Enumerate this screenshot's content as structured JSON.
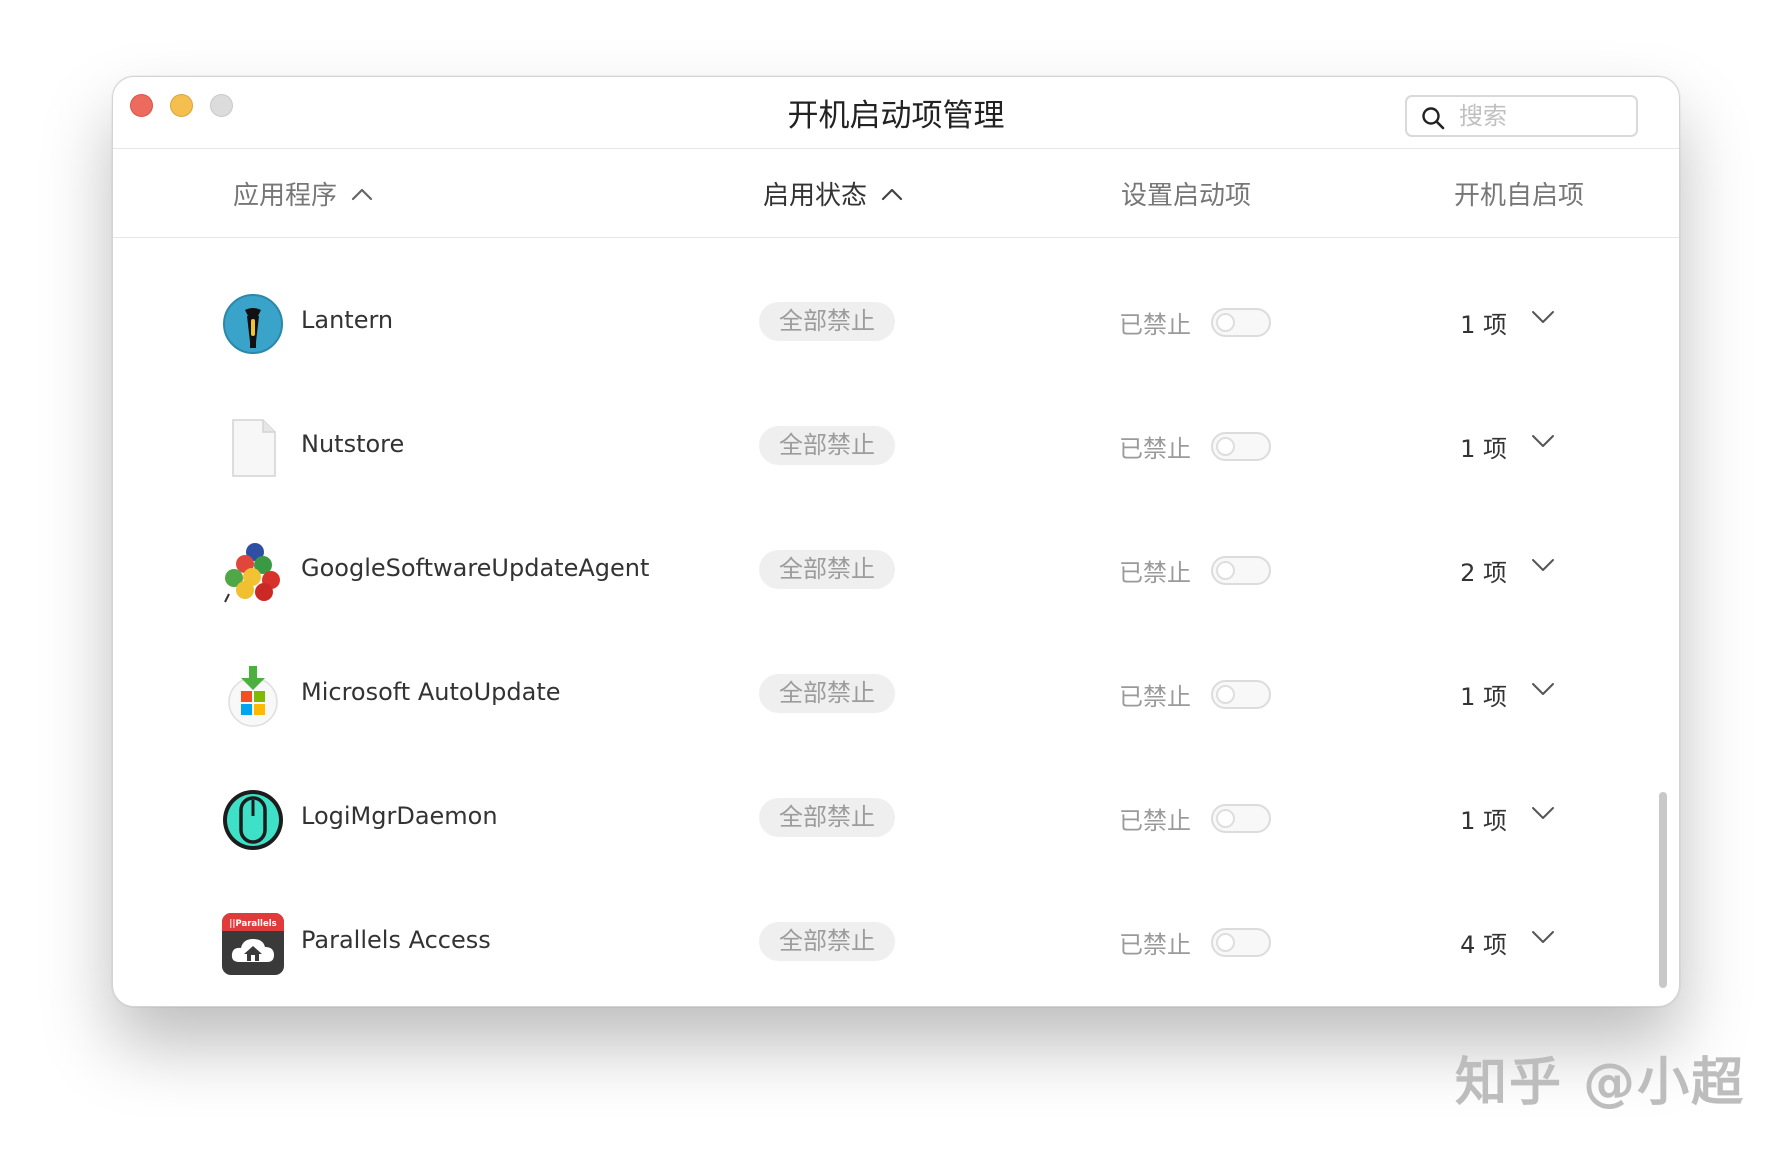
{
  "window": {
    "title": "开机启动项管理"
  },
  "search": {
    "placeholder": "搜索"
  },
  "columns": {
    "apps": "应用程序",
    "status": "启用状态",
    "setting": "设置启动项",
    "autostart": "开机自启项"
  },
  "rows": [
    {
      "name": "Lantern",
      "icon": "lantern-icon",
      "status": "全部禁止",
      "setting_label": "已禁止",
      "enabled": false,
      "count": "1 项"
    },
    {
      "name": "Nutstore",
      "icon": "document-icon",
      "status": "全部禁止",
      "setting_label": "已禁止",
      "enabled": false,
      "count": "1 项"
    },
    {
      "name": "GoogleSoftwareUpdateAgent",
      "icon": "colored-balls-icon",
      "status": "全部禁止",
      "setting_label": "已禁止",
      "enabled": false,
      "count": "2 项"
    },
    {
      "name": "Microsoft AutoUpdate",
      "icon": "microsoft-autoupdate-icon",
      "status": "全部禁止",
      "setting_label": "已禁止",
      "enabled": false,
      "count": "1 项"
    },
    {
      "name": "LogiMgrDaemon",
      "icon": "logitech-mouse-icon",
      "status": "全部禁止",
      "setting_label": "已禁止",
      "enabled": false,
      "count": "1 项"
    },
    {
      "name": "Parallels Access",
      "icon": "parallels-access-icon",
      "icon_text": "||Parallels",
      "status": "全部禁止",
      "setting_label": "已禁止",
      "enabled": false,
      "count": "4 项"
    }
  ],
  "watermark": "知乎 @小超",
  "colors": {
    "close": "#ed6a5e",
    "minimize": "#f5bf4f",
    "zoom": "#dcdcdc",
    "badge_bg": "#efefef"
  }
}
